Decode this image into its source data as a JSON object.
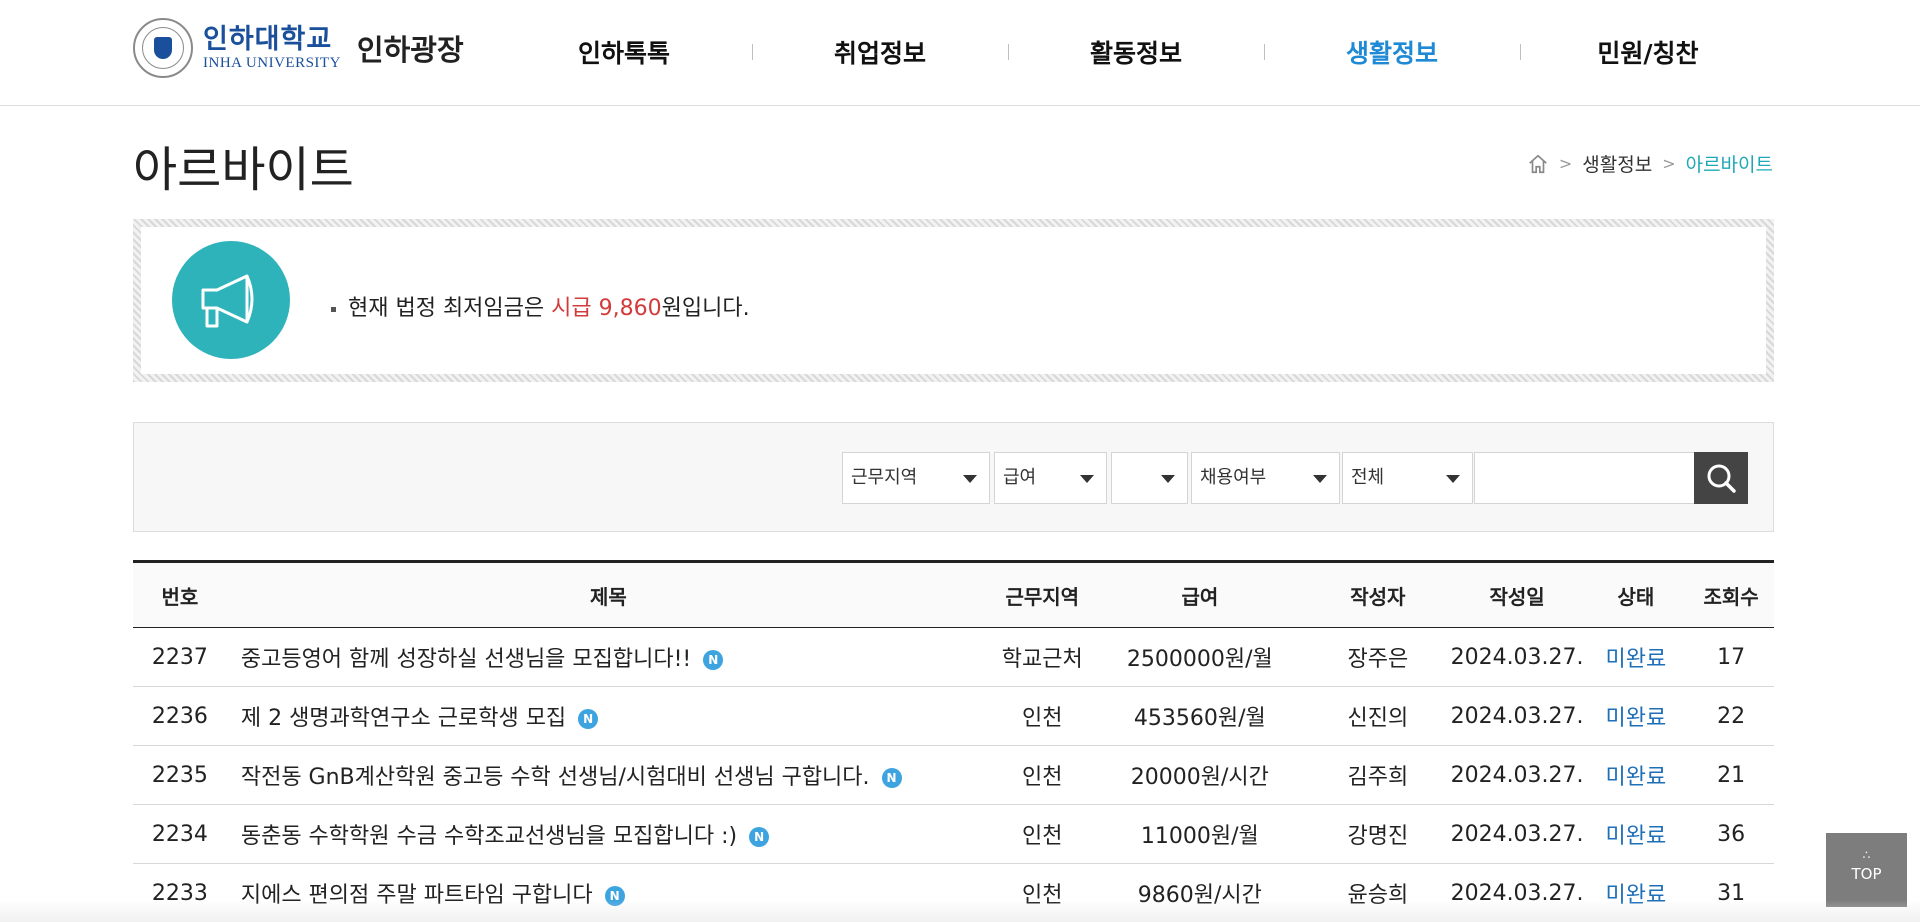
{
  "header": {
    "logo_ko": "인하대학교",
    "logo_en": "INHA UNIVERSITY",
    "site_name": "인하광장",
    "nav": [
      {
        "label": "인하톡톡"
      },
      {
        "label": "취업정보"
      },
      {
        "label": "활동정보"
      },
      {
        "label": "생활정보",
        "active": true
      },
      {
        "label": "민원/칭찬"
      }
    ]
  },
  "page": {
    "title": "아르바이트",
    "breadcrumb": {
      "icon": "home-icon",
      "items": [
        "생활정보",
        "아르바이트"
      ]
    }
  },
  "notice": {
    "icon": "megaphone-icon",
    "text_before": "현재 법정 최저임금은 ",
    "highlight": "시급 9,860",
    "text_after": "원입니다."
  },
  "search": {
    "filters": [
      {
        "value": "근무지역"
      },
      {
        "value": "급여"
      },
      {
        "value": ""
      },
      {
        "value": "채용여부"
      },
      {
        "value": "전체"
      }
    ],
    "query": "",
    "button_icon": "search-icon"
  },
  "table": {
    "headers": [
      "번호",
      "제목",
      "근무지역",
      "급여",
      "작성자",
      "작성일",
      "상태",
      "조회수"
    ],
    "rows": [
      {
        "no": "2237",
        "title": "중고등영어 함께 성장하실 선생님을 모집합니다!!",
        "region": "학교근처",
        "pay": "2500000원/월",
        "author": "장주은",
        "date": "2024.03.27.",
        "status": "미완료",
        "views": "17"
      },
      {
        "no": "2236",
        "title": "제 2 생명과학연구소 근로학생 모집",
        "region": "인천",
        "pay": "453560원/월",
        "author": "신진의",
        "date": "2024.03.27.",
        "status": "미완료",
        "views": "22"
      },
      {
        "no": "2235",
        "title": "작전동 GnB계산학원 중고등 수학 선생님/시험대비 선생님 구합니다.",
        "region": "인천",
        "pay": "20000원/시간",
        "author": "김주희",
        "date": "2024.03.27.",
        "status": "미완료",
        "views": "21"
      },
      {
        "no": "2234",
        "title": "동춘동 수학학원 수금 수학조교선생님을 모집합니다 :)",
        "region": "인천",
        "pay": "11000원/월",
        "author": "강명진",
        "date": "2024.03.27.",
        "status": "미완료",
        "views": "36"
      },
      {
        "no": "2233",
        "title": "지에스 편의점 주말 파트타임 구합니다",
        "region": "인천",
        "pay": "9860원/시간",
        "author": "윤승희",
        "date": "2024.03.27.",
        "status": "미완료",
        "views": "31"
      }
    ],
    "new_badge": "N"
  },
  "top_button": {
    "label": "TOP",
    "icon": "arrow-up-icon"
  }
}
